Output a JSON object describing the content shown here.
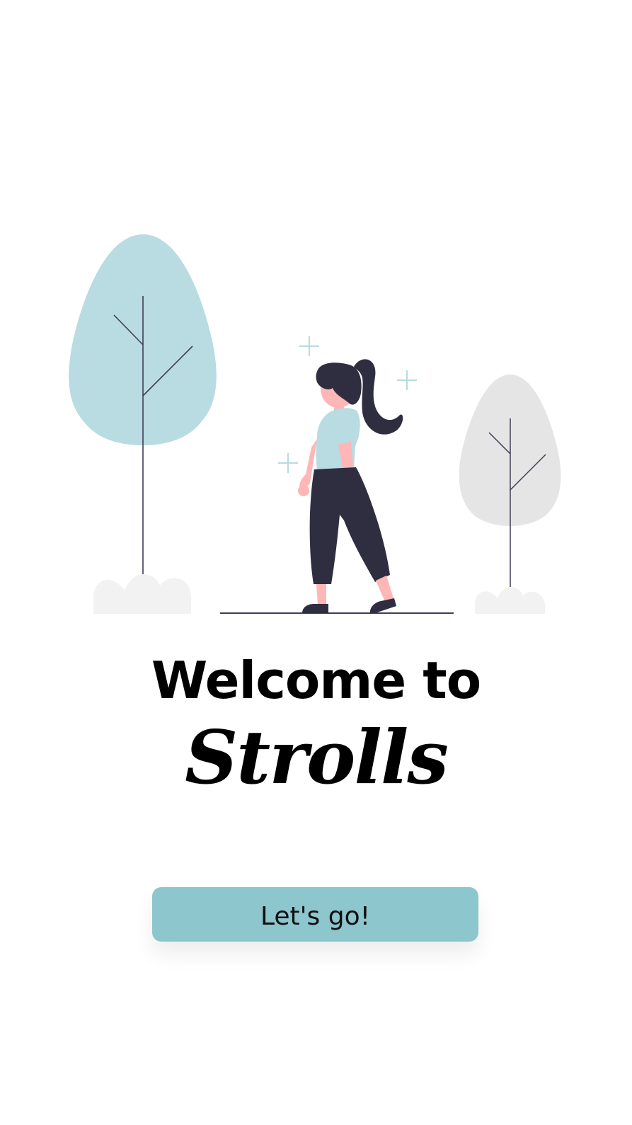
{
  "welcome": {
    "title": "Welcome to",
    "brand": "Strolls"
  },
  "actions": {
    "start_label": "Let's go!"
  },
  "colors": {
    "accent": "#8dc6cd",
    "tree_left": "#b8dce1",
    "tree_right": "#e5e5e5",
    "bush": "#f2f2f2",
    "outline": "#3f3d56",
    "figure_dark": "#2f2e41",
    "skin": "#ffb6b6",
    "background": "#ffffff"
  }
}
